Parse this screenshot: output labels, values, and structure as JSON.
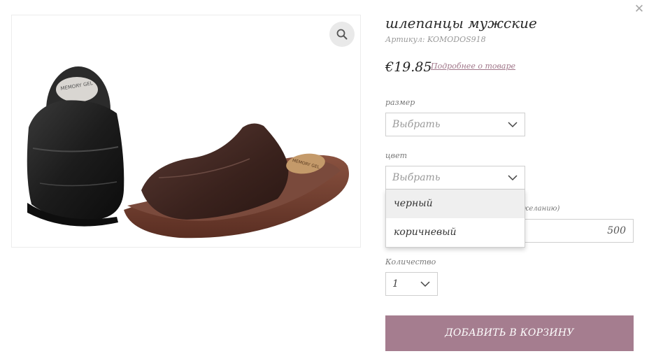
{
  "product": {
    "title": "шлепанцы мужские",
    "sku": "Артикул: KOMODOS918",
    "price": "€19.85",
    "details_link": "Подробнее о товаре",
    "image_brand_text": "MEMORY GEL"
  },
  "options": {
    "size": {
      "label": "размер",
      "placeholder": "Выбрать"
    },
    "color": {
      "label": "цвет",
      "placeholder": "Выбрать",
      "dropdown_items": [
        "черный",
        "коричневый"
      ],
      "highlighted_item": "черный"
    },
    "amount": {
      "label_fragment": "желанию)",
      "value": "500"
    },
    "quantity": {
      "label": "Количество",
      "value": "1"
    }
  },
  "actions": {
    "add_to_cart": "ДОБАВИТЬ В КОРЗИНУ"
  },
  "icons": {
    "close": "close-icon",
    "zoom": "magnifier-icon",
    "chevron": "chevron-down-icon"
  },
  "colors": {
    "accent": "#a57d8f",
    "link": "#a07689",
    "border": "#cfcfcf",
    "zoom_bg": "#e9e9e9"
  }
}
